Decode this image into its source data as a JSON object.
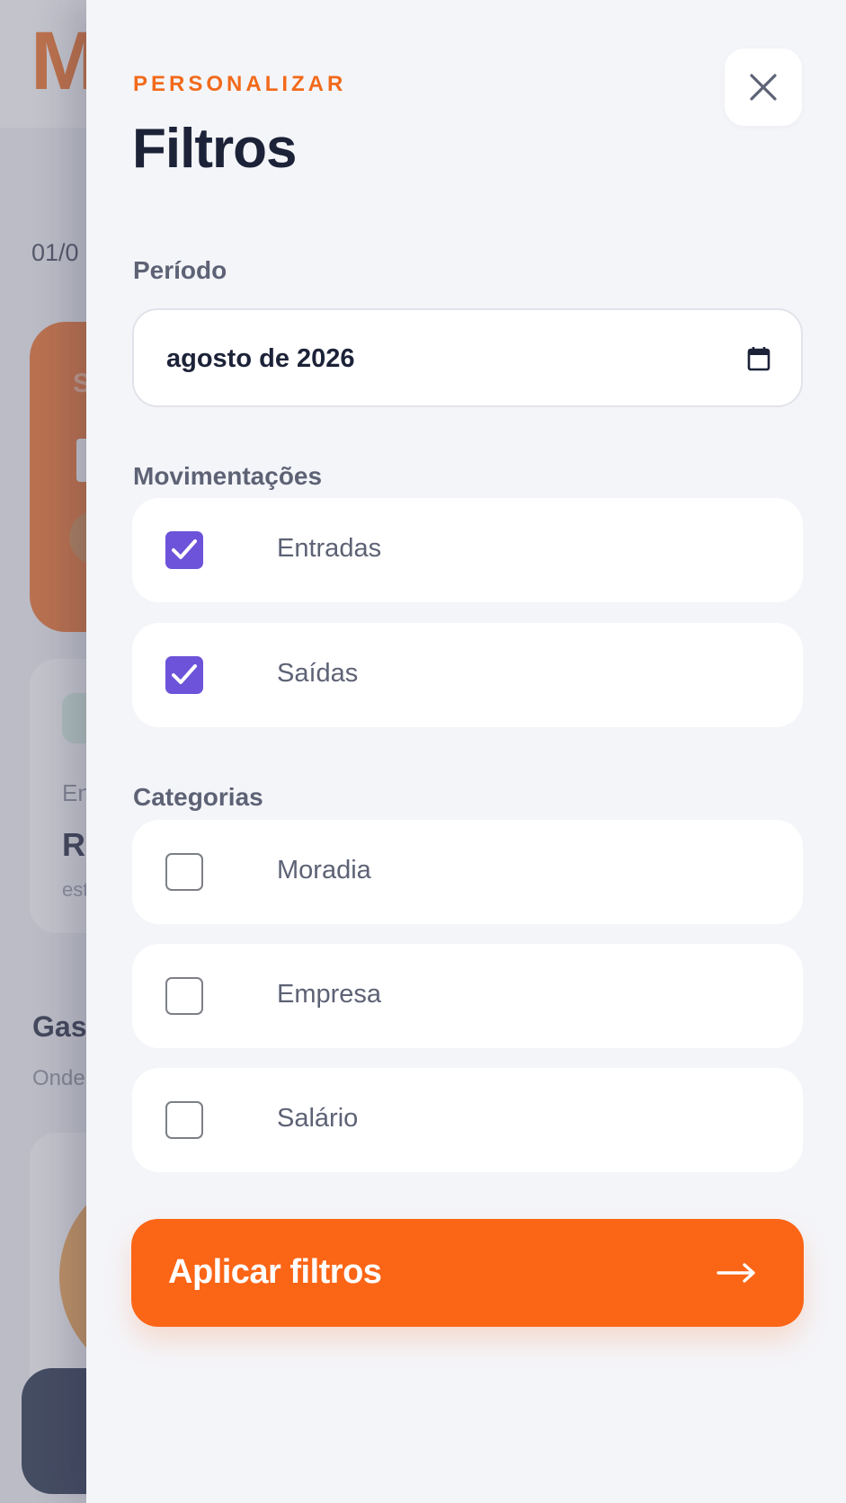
{
  "background": {
    "logo_letter": "M",
    "date_fragment": "01/0",
    "card_letter": "S",
    "entradas_fragment": "En",
    "amount_fragment": "R:",
    "note_fragment": "est",
    "section_fragment": "Gas",
    "subtitle_fragment": "Onde"
  },
  "drawer": {
    "eyebrow": "PERSONALIZAR",
    "title": "Filtros",
    "close_icon": "close-icon",
    "period": {
      "label": "Período",
      "value": "agosto de 2026",
      "icon": "calendar-icon"
    },
    "movements": {
      "label": "Movimentações",
      "options": [
        {
          "label": "Entradas",
          "checked": true
        },
        {
          "label": "Saídas",
          "checked": true
        }
      ]
    },
    "categories": {
      "label": "Categorias",
      "options": [
        {
          "label": "Moradia",
          "checked": false
        },
        {
          "label": "Empresa",
          "checked": false
        },
        {
          "label": "Salário",
          "checked": false
        }
      ]
    },
    "apply_label": "Aplicar filtros",
    "apply_icon": "arrow-right-icon"
  },
  "colors": {
    "accent": "#fb6516",
    "checkbox": "#6c53d9",
    "title": "#1c2238"
  }
}
